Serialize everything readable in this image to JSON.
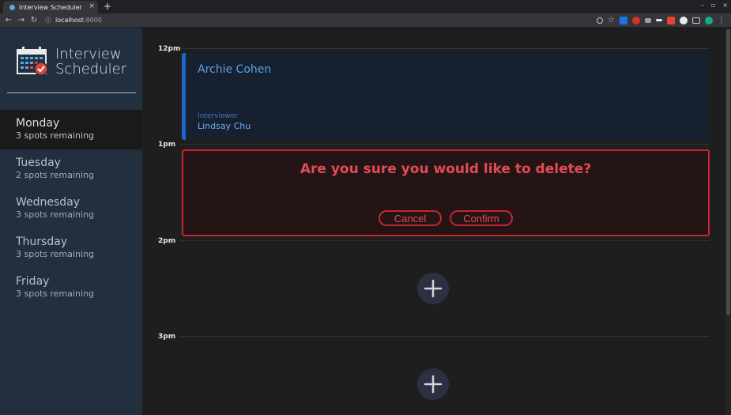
{
  "browser": {
    "tab_title": "Interview Scheduler",
    "tab_close": "×",
    "new_tab": "+",
    "url_host": "localhost",
    "url_port": ":8000",
    "win_min": "–",
    "win_max": "▫",
    "win_close": "×"
  },
  "sidebar": {
    "logo_line1": "Interview",
    "logo_line2": "Scheduler",
    "days": [
      {
        "name": "Monday",
        "spots": "3 spots remaining",
        "selected": true
      },
      {
        "name": "Tuesday",
        "spots": "2 spots remaining",
        "selected": false
      },
      {
        "name": "Wednesday",
        "spots": "3 spots remaining",
        "selected": false
      },
      {
        "name": "Thursday",
        "spots": "3 spots remaining",
        "selected": false
      },
      {
        "name": "Friday",
        "spots": "3 spots remaining",
        "selected": false
      }
    ]
  },
  "schedule": {
    "times": [
      "12pm",
      "1pm",
      "2pm",
      "3pm"
    ],
    "appointment": {
      "student": "Archie Cohen",
      "interviewer_heading": "Interviewer",
      "interviewer_name": "Lindsay Chu"
    },
    "confirm": {
      "message": "Are you sure you would like to delete?",
      "cancel_label": "Cancel",
      "confirm_label": "Confirm"
    }
  },
  "colors": {
    "sidebar_bg": "#222f3e",
    "main_bg": "#1e1e1e",
    "accent_blue": "#1f64c8",
    "danger_red": "#c3262c"
  }
}
